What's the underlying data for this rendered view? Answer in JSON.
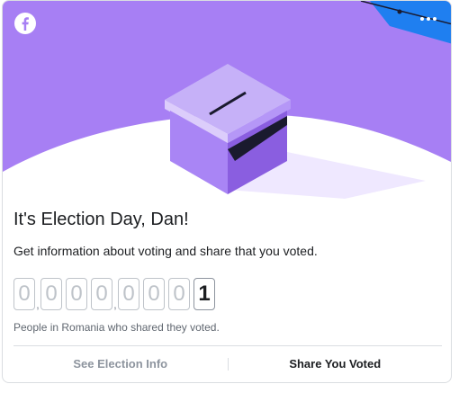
{
  "colors": {
    "hero_purple": "#a77ff4",
    "box_top": "#c6b1f8",
    "box_front": "#a985f5",
    "box_side": "#8a5ee0",
    "accent_blue": "#1f7ff0"
  },
  "icons": {
    "brand": "facebook-icon",
    "menu": "more-horizontal-icon",
    "illustration": "ballot-box-icon"
  },
  "card": {
    "title": "It's Election Day, Dan!",
    "subtitle": "Get information about voting and share that you voted.",
    "counter_digits": [
      "0",
      "0",
      "0",
      "0",
      "0",
      "0",
      "0",
      "1"
    ],
    "counter_separators": [
      ",",
      ","
    ],
    "caption": "People in Romania who shared they voted."
  },
  "actions": {
    "election_info": "See Election Info",
    "share_voted": "Share You Voted"
  }
}
